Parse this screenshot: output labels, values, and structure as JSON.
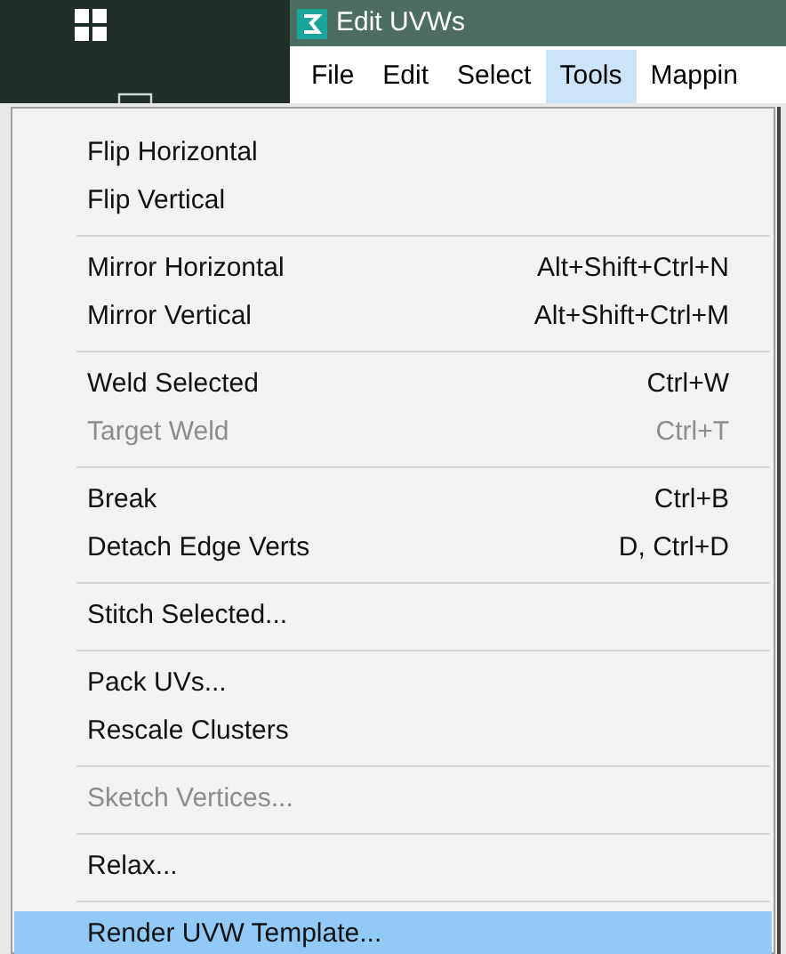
{
  "window": {
    "title": "Edit UVWs"
  },
  "menu_bar": [
    {
      "label": "File",
      "selected": false
    },
    {
      "label": "Edit",
      "selected": false
    },
    {
      "label": "Select",
      "selected": false
    },
    {
      "label": "Tools",
      "selected": true
    },
    {
      "label": "Mappin",
      "selected": false
    }
  ],
  "menu": [
    [
      {
        "label": "Flip Horizontal",
        "disabled": false,
        "selected": false
      },
      {
        "label": "Flip Vertical",
        "disabled": false,
        "selected": false
      }
    ],
    [
      {
        "label": "Mirror Horizontal",
        "shortcut": "Alt+Shift+Ctrl+N",
        "disabled": false,
        "selected": false
      },
      {
        "label": "Mirror Vertical",
        "shortcut": "Alt+Shift+Ctrl+M",
        "disabled": false,
        "selected": false
      }
    ],
    [
      {
        "label": "Weld Selected",
        "shortcut": "Ctrl+W",
        "disabled": false,
        "selected": false
      },
      {
        "label": "Target Weld",
        "shortcut": "Ctrl+T",
        "disabled": true,
        "selected": false
      }
    ],
    [
      {
        "label": "Break",
        "shortcut": "Ctrl+B",
        "disabled": false,
        "selected": false
      },
      {
        "label": "Detach Edge Verts",
        "shortcut": "D, Ctrl+D",
        "disabled": false,
        "selected": false
      }
    ],
    [
      {
        "label": "Stitch Selected...",
        "disabled": false,
        "selected": false
      }
    ],
    [
      {
        "label": "Pack UVs...",
        "disabled": false,
        "selected": false
      },
      {
        "label": "Rescale Clusters",
        "disabled": false,
        "selected": false
      }
    ],
    [
      {
        "label": "Sketch Vertices...",
        "disabled": true,
        "selected": false
      }
    ],
    [
      {
        "label": "Relax...",
        "disabled": false,
        "selected": false
      }
    ],
    [
      {
        "label": "Render UVW Template...",
        "disabled": false,
        "selected": true
      }
    ]
  ]
}
